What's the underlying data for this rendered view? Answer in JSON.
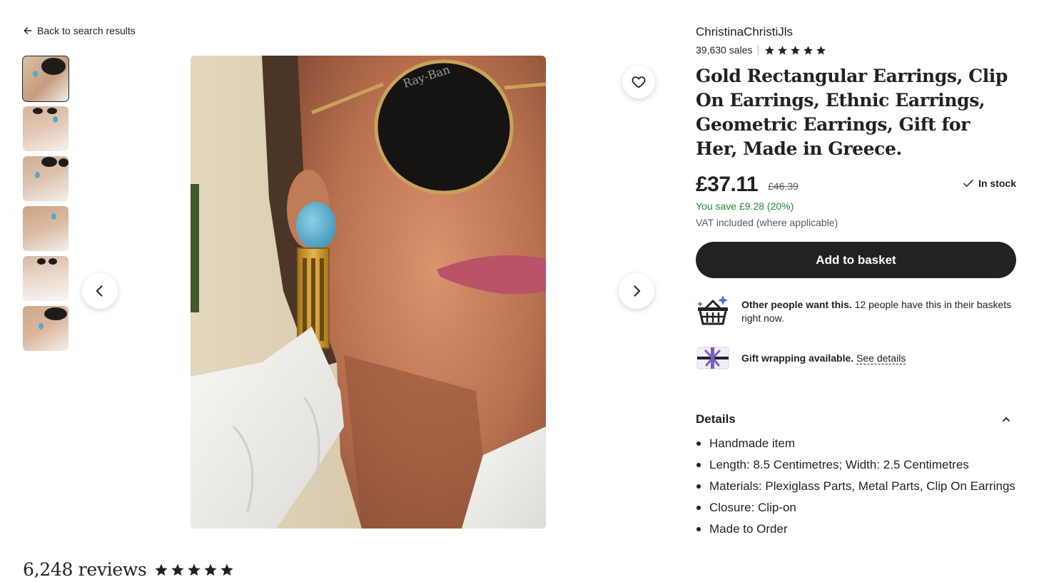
{
  "nav": {
    "back_label": "Back to search results",
    "back_icon": "arrow-left-icon"
  },
  "gallery": {
    "thumbnail_count": 6,
    "active_index": 0,
    "prev_icon": "chevron-left-icon",
    "next_icon": "chevron-right-icon",
    "favorite_icon": "heart-icon"
  },
  "reviews": {
    "count_label": "6,248 reviews",
    "rating": 5
  },
  "shop": {
    "name": "ChristinaChristiJls",
    "sales": "39,630 sales",
    "rating": 5
  },
  "product": {
    "title": "Gold Rectangular Earrings, Clip On Earrings, Ethnic Earrings, Geometric Earrings, Gift for Her, Made in Greece.",
    "price": "£37.11",
    "original_price": "£46.39",
    "stock_status": "In stock",
    "savings": "You save £9.28 (20%)",
    "vat_note": "VAT included (where applicable)",
    "add_to_basket_label": "Add to basket"
  },
  "promos": {
    "demand_bold": "Other people want this.",
    "demand_text": " 12 people have this in their baskets right now.",
    "gift_bold": "Gift wrapping available.",
    "gift_link": "See details"
  },
  "details": {
    "heading": "Details",
    "items": [
      "Handmade item",
      "Length: 8.5 Centimetres; Width: 2.5 Centimetres",
      "Materials: Plexiglass Parts, Metal Parts, Clip On Earrings",
      "Closure: Clip-on",
      "Made to Order"
    ]
  },
  "colors": {
    "text": "#222222",
    "savings_green": "#258635",
    "button_dark": "#222222",
    "earring_blue": "#57a9c9",
    "earring_gold": "#c99a2e"
  }
}
